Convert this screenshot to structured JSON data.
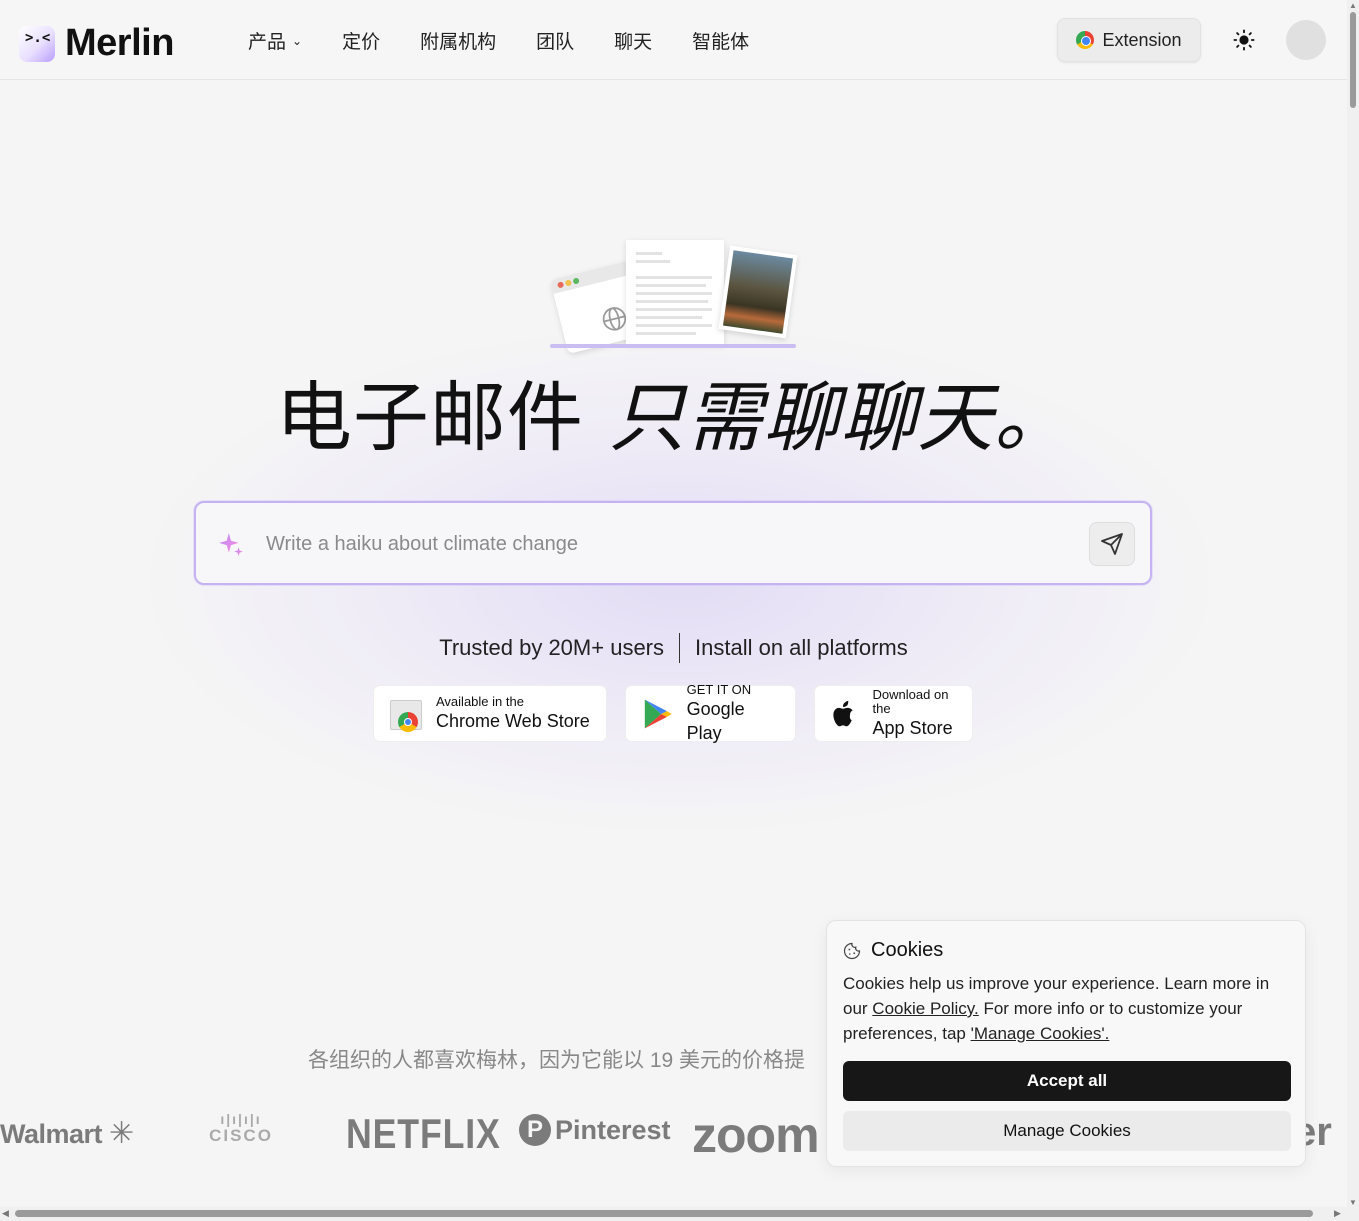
{
  "header": {
    "logo_text": "Merlin",
    "logo_glyph": ">.<",
    "nav": [
      {
        "label": "产品",
        "has_dropdown": true
      },
      {
        "label": "定价"
      },
      {
        "label": "附属机构"
      },
      {
        "label": "团队"
      },
      {
        "label": "聊天"
      },
      {
        "label": "智能体"
      }
    ],
    "extension_label": "Extension"
  },
  "hero": {
    "headline_regular": "电子邮件 ",
    "headline_italic": "只需聊聊天。",
    "search_placeholder": "Write a haiku about climate change",
    "trust_left": "Trusted by 20M+ users",
    "trust_right": "Install on all platforms",
    "stores": [
      {
        "small": "Available in the",
        "big": "Chrome Web Store",
        "icon": "chrome-web-store-icon"
      },
      {
        "small": "GET IT ON",
        "big": "Google Play",
        "icon": "google-play-icon"
      },
      {
        "small": "Download on the",
        "big": "App Store",
        "icon": "apple-icon"
      }
    ]
  },
  "orgs": {
    "text": "各组织的人都喜欢梅林，因为它能以 19 美元的价格提"
  },
  "logos": [
    "Walmart",
    "CISCO",
    "NETFLIX",
    "Pinterest",
    "zoom",
    "er"
  ],
  "cookies": {
    "title": "Cookies",
    "text_1": "Cookies help us improve your experience. Learn more in our ",
    "link_policy": "Cookie Policy.",
    "text_2": " For more info or to customize your preferences, tap ",
    "link_manage": "'Manage Cookies'.",
    "accept_label": "Accept all",
    "manage_label": "Manage Cookies"
  },
  "colors": {
    "accent_border": "#c4b3f0",
    "button_dark": "#171717",
    "background": "#f5f5f5"
  }
}
